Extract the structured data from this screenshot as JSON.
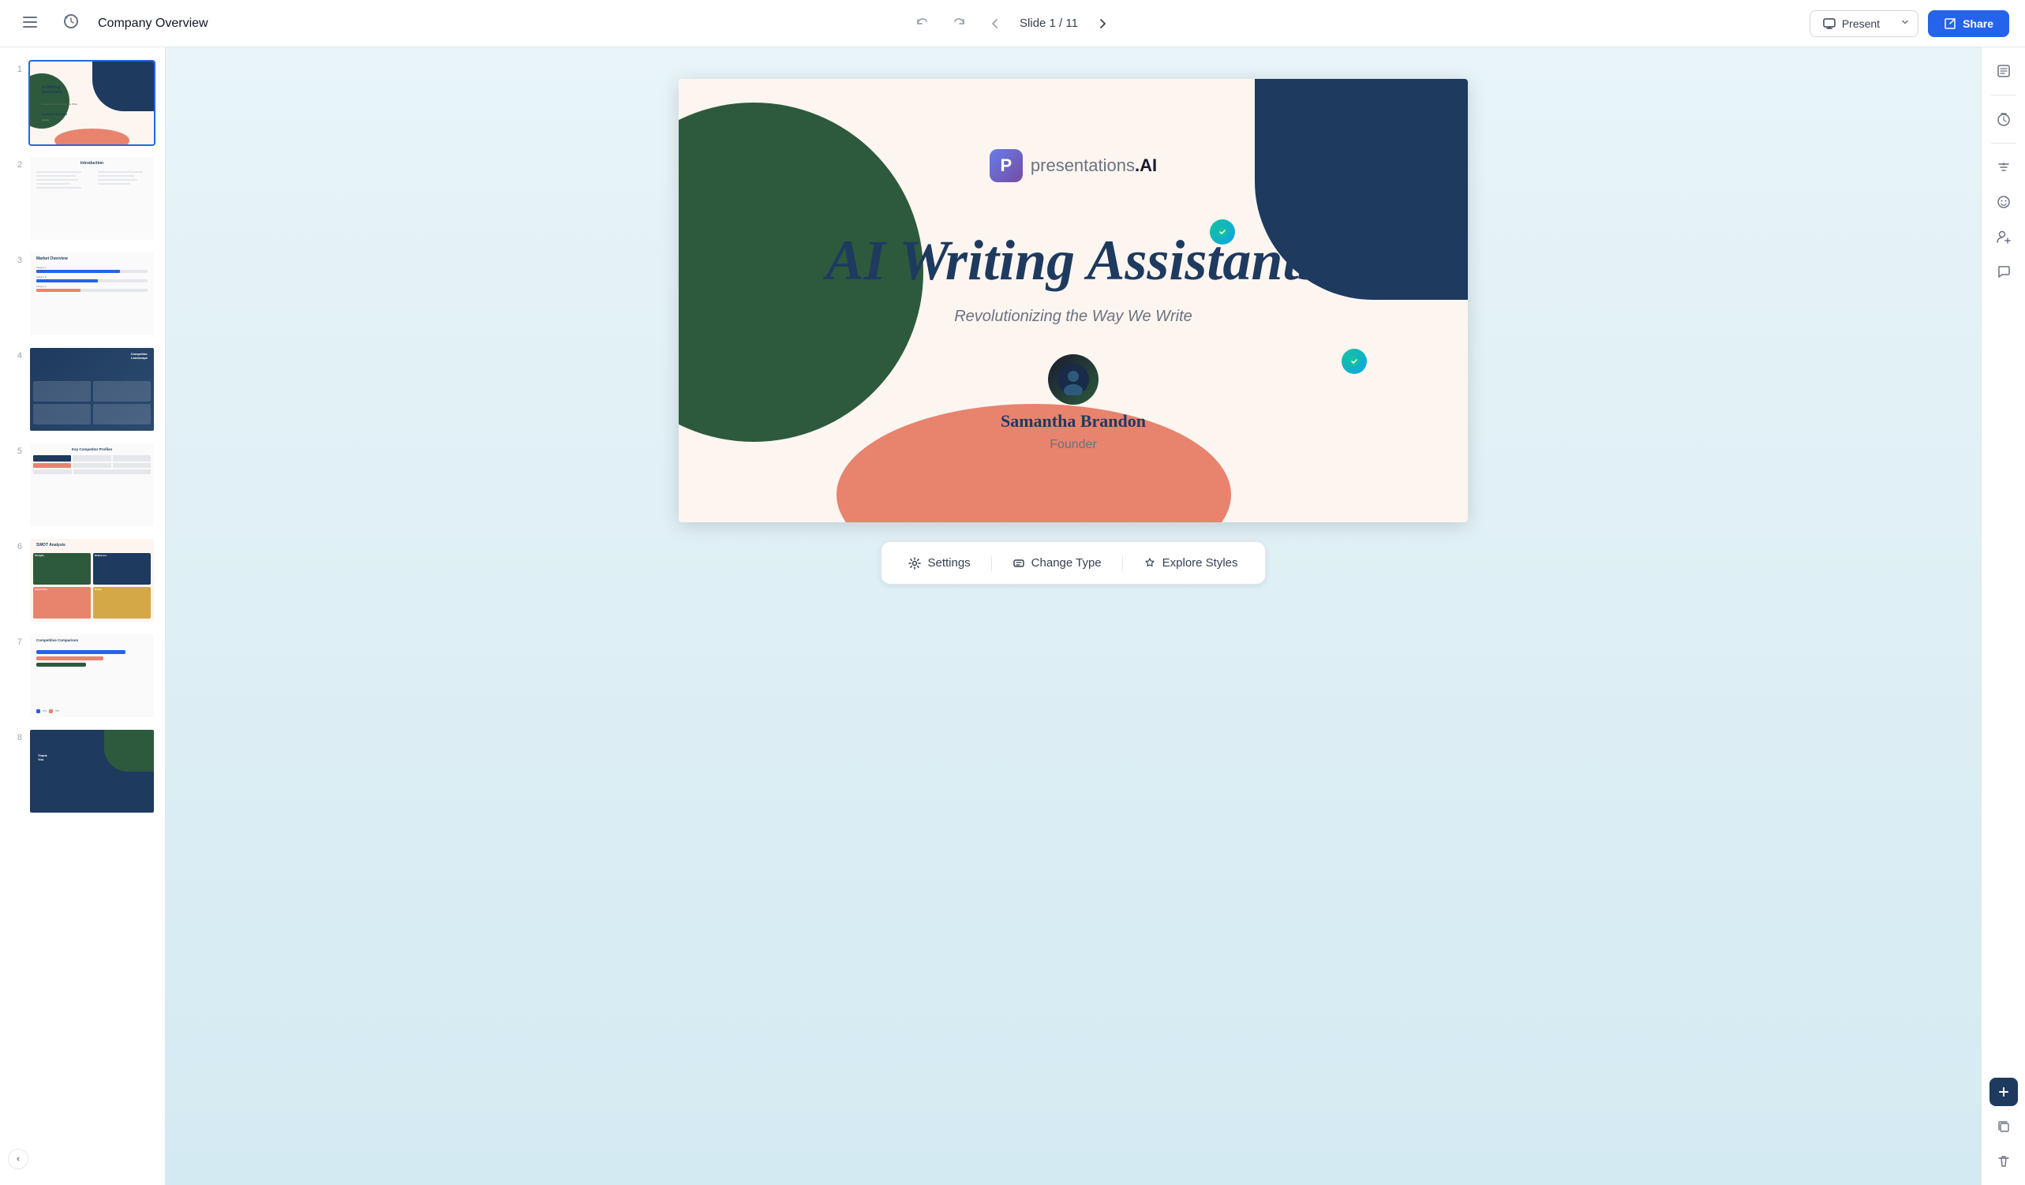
{
  "topbar": {
    "menu_icon": "≡",
    "history_icon": "↺",
    "doc_title": "Company Overview",
    "undo_icon": "←",
    "redo_icon": "→",
    "prev_slide_icon": "←",
    "next_slide_icon": "→",
    "slide_indicator": "Slide 1 / 11",
    "present_label": "Present",
    "present_dropdown_icon": "▾",
    "share_icon": "↗",
    "share_label": "Share"
  },
  "slides": [
    {
      "number": "1",
      "active": true
    },
    {
      "number": "2",
      "active": false
    },
    {
      "number": "3",
      "active": false
    },
    {
      "number": "4",
      "active": false
    },
    {
      "number": "5",
      "active": false
    },
    {
      "number": "6",
      "active": false
    },
    {
      "number": "7",
      "active": false
    },
    {
      "number": "8",
      "active": false
    }
  ],
  "slide1": {
    "logo_letter": "P",
    "logo_text": "presentations",
    "logo_suffix": ".AI",
    "main_title": "AI Writing Assistants",
    "subtitle": "Revolutionizing the Way We Write",
    "author_name": "Samantha Brandon",
    "author_role": "Founder",
    "avatar_icon": "🌐"
  },
  "slide4": {
    "label": "Competitor Landscape"
  },
  "toolbar": {
    "settings_icon": "⚙",
    "settings_label": "Settings",
    "change_type_icon": "⬡",
    "change_type_label": "Change Type",
    "explore_icon": "✦",
    "explore_label": "Explore Styles"
  },
  "right_sidebar": {
    "notes_icon": "≡",
    "timer_icon": "◷",
    "filters_icon": "⚡",
    "emoji_icon": "☺",
    "add_user_icon": "👤",
    "chat_icon": "💬",
    "add_btn": "+",
    "copy_icon": "⧉",
    "delete_icon": "🗑"
  }
}
